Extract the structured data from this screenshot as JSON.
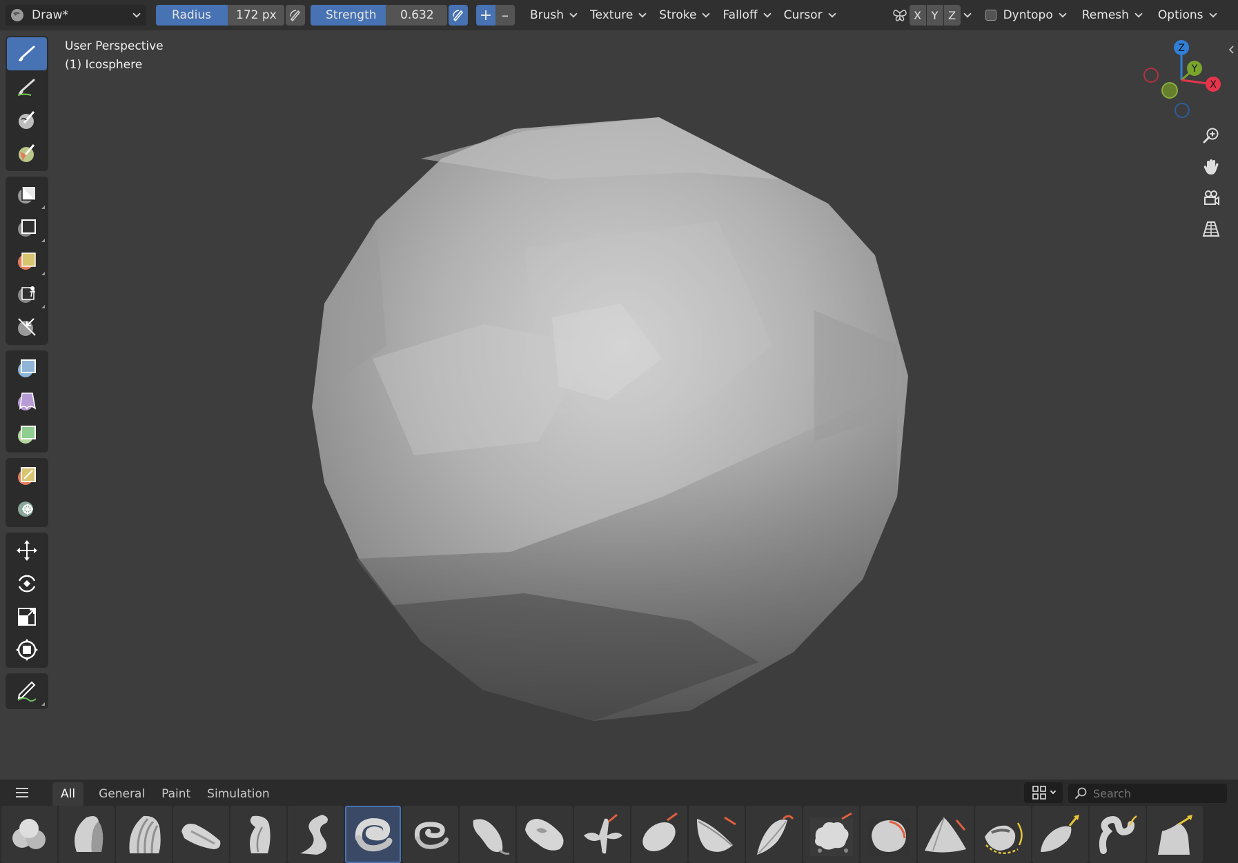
{
  "header": {
    "mode_label": "Draw*",
    "radius_label": "Radius",
    "radius_value": "172 px",
    "strength_label": "Strength",
    "strength_value": "0.632",
    "strength_fraction": 0.632,
    "plus_symbol": "+",
    "minus_symbol": "–",
    "menus": [
      "Brush",
      "Texture",
      "Stroke",
      "Falloff",
      "Cursor"
    ],
    "axes": [
      "X",
      "Y",
      "Z"
    ],
    "dyntopo_label": "Dyntopo",
    "remesh_label": "Remesh",
    "options_label": "Options"
  },
  "viewport": {
    "line1": "User Perspective",
    "line2": "(1) Icosphere"
  },
  "gizmo": {
    "z": "Z",
    "y": "Y",
    "x": "X"
  },
  "shelf": {
    "tabs": [
      "All",
      "General",
      "Paint",
      "Simulation"
    ],
    "active_tab": "All",
    "search_placeholder": "Search",
    "selected_index": 6,
    "brush_count": 21
  },
  "colors": {
    "accent": "#4772b3",
    "axis_x": "#e5354b",
    "axis_y": "#7aa52c",
    "axis_z": "#2f7fd6"
  }
}
